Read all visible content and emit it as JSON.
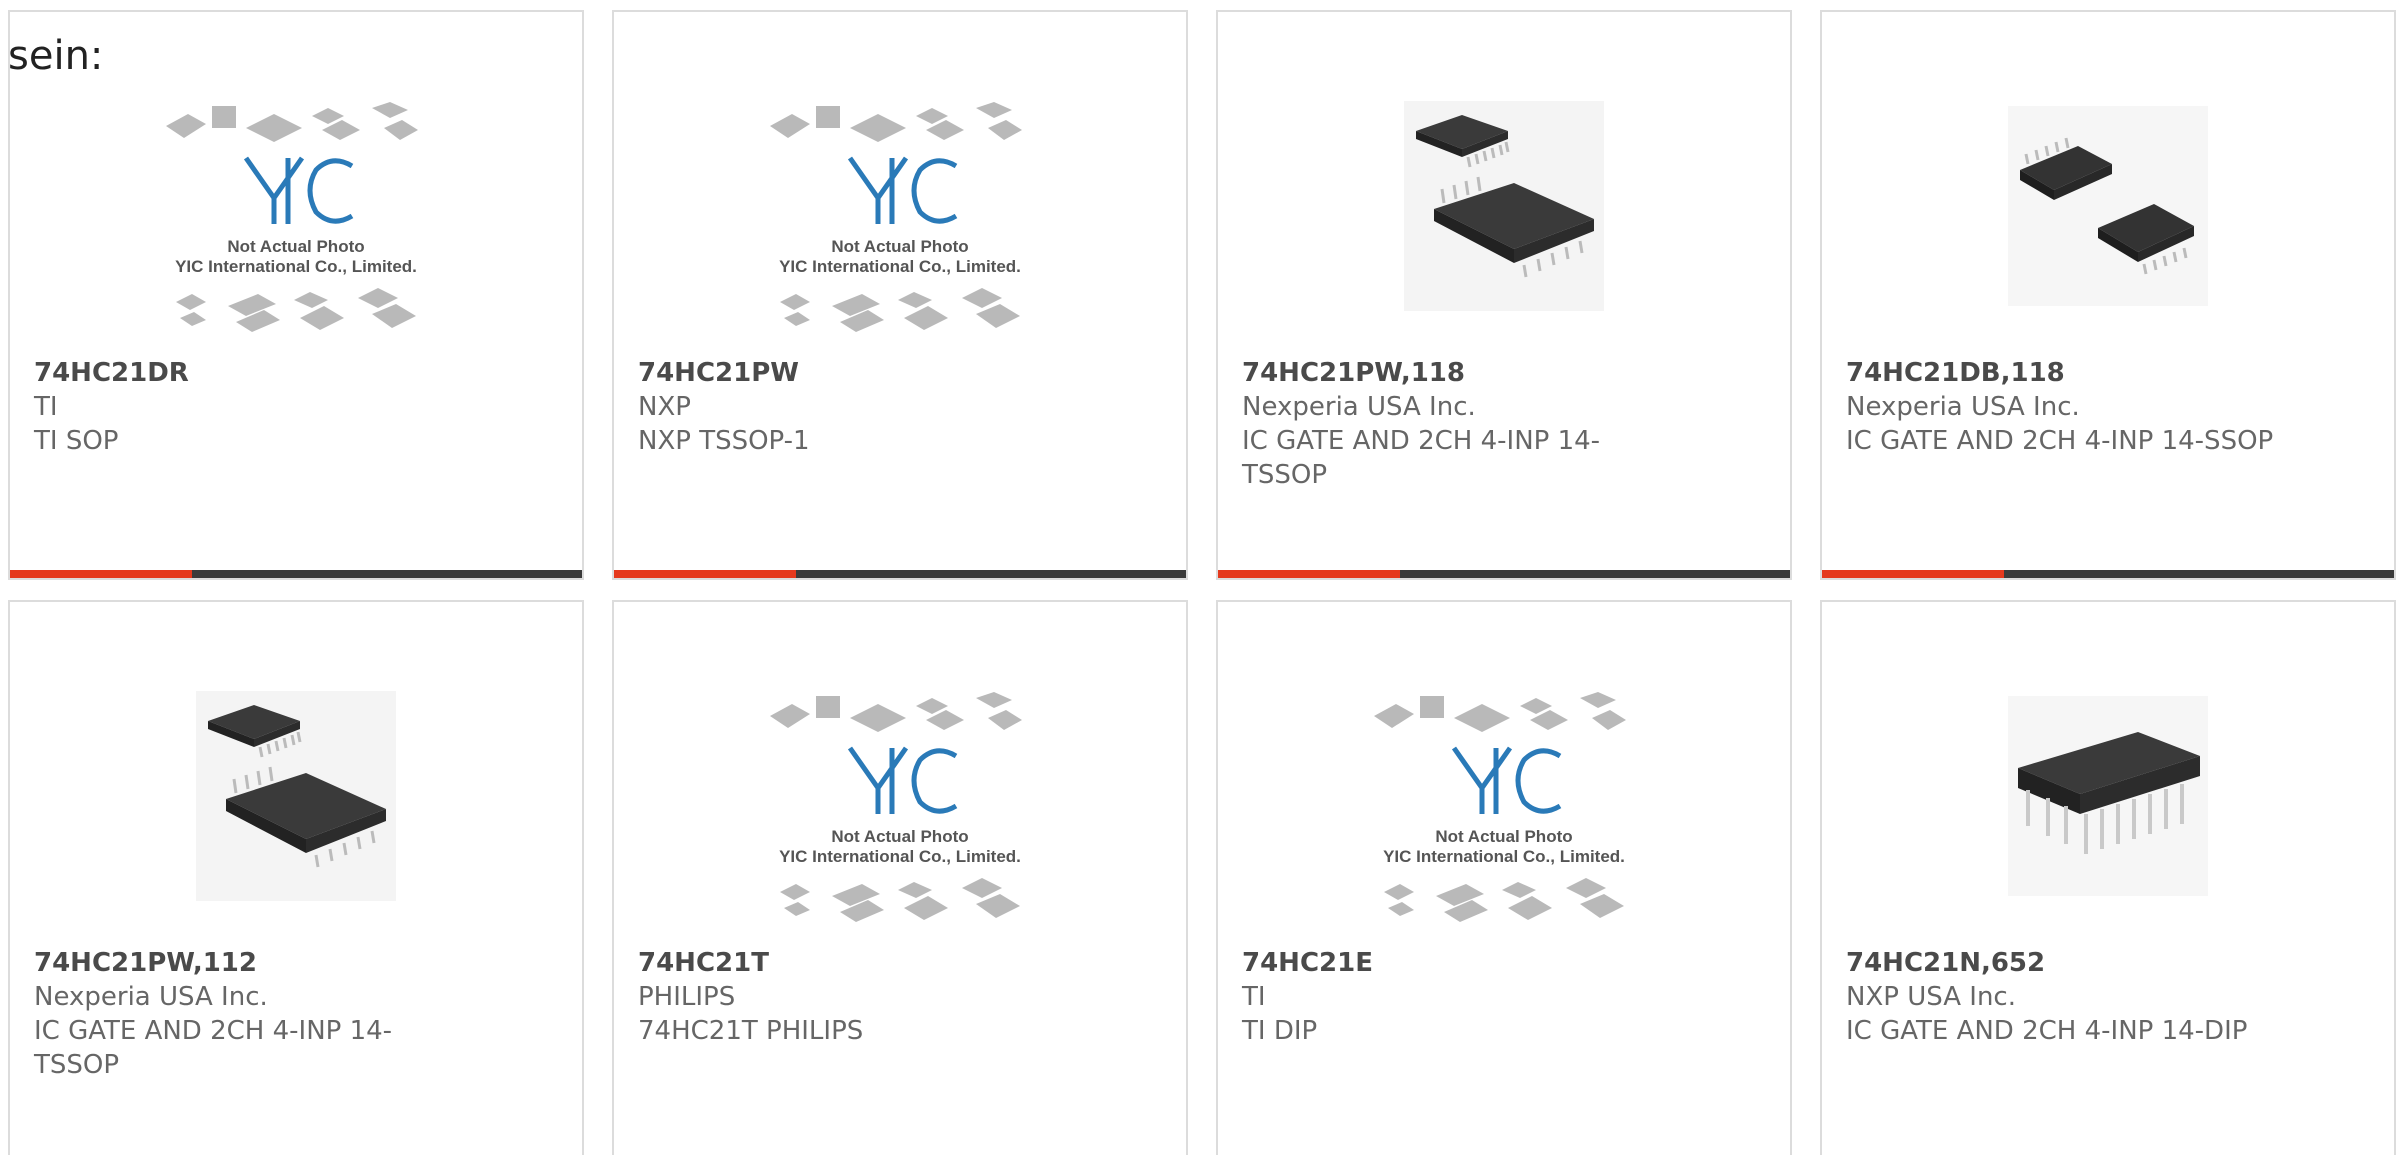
{
  "heading": "sein:",
  "accent_color": "#e5391d",
  "bar_color": "#3b3b3b",
  "placeholder": {
    "logo": "YIC",
    "line1": "Not Actual Photo",
    "line2": "YIC International Co., Limited."
  },
  "products": [
    {
      "part": "74HC21DR",
      "manufacturer": "TI",
      "description": "TI SOP",
      "image": "placeholder"
    },
    {
      "part": "74HC21PW",
      "manufacturer": "NXP",
      "description": "NXP TSSOP-1",
      "image": "placeholder"
    },
    {
      "part": "74HC21PW,118",
      "manufacturer": "Nexperia USA Inc.",
      "description": "IC GATE AND 2CH 4-INP 14-TSSOP",
      "image": "tssop-chip"
    },
    {
      "part": "74HC21DB,118",
      "manufacturer": "Nexperia USA Inc.",
      "description": "IC GATE AND 2CH 4-INP 14-SSOP",
      "image": "ssop-chip"
    },
    {
      "part": "74HC21PW,112",
      "manufacturer": "Nexperia USA Inc.",
      "description": "IC GATE AND 2CH 4-INP 14-TSSOP",
      "image": "tssop-chip"
    },
    {
      "part": "74HC21T",
      "manufacturer": "PHILIPS",
      "description": "74HC21T PHILIPS",
      "image": "placeholder"
    },
    {
      "part": "74HC21E",
      "manufacturer": "TI",
      "description": "TI DIP",
      "image": "placeholder"
    },
    {
      "part": "74HC21N,652",
      "manufacturer": "NXP USA Inc.",
      "description": "IC GATE AND 2CH 4-INP 14-DIP",
      "image": "dip-chip"
    }
  ]
}
